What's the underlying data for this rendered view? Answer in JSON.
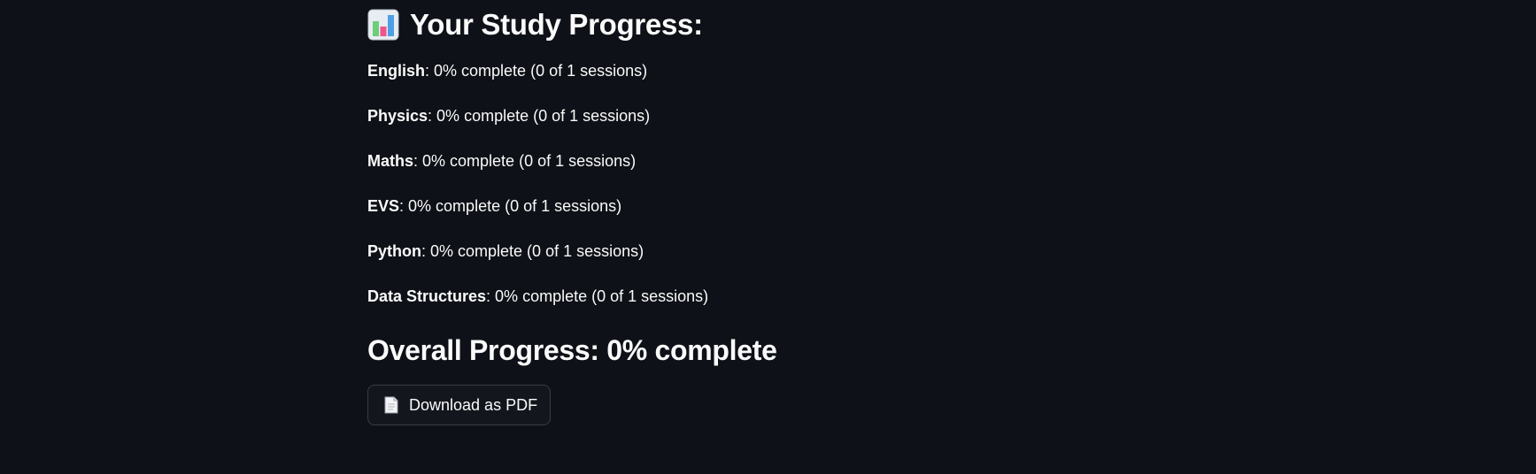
{
  "header": {
    "icon": "bar-chart-icon",
    "title": "Your Study Progress:"
  },
  "subjects": [
    {
      "name": "English",
      "suffix": ": 0% complete (0 of 1 sessions)",
      "percent": 0,
      "done": 0,
      "total": 1
    },
    {
      "name": "Physics",
      "suffix": ": 0% complete (0 of 1 sessions)",
      "percent": 0,
      "done": 0,
      "total": 1
    },
    {
      "name": "Maths",
      "suffix": ": 0% complete (0 of 1 sessions)",
      "percent": 0,
      "done": 0,
      "total": 1
    },
    {
      "name": "EVS",
      "suffix": ": 0% complete (0 of 1 sessions)",
      "percent": 0,
      "done": 0,
      "total": 1
    },
    {
      "name": "Python",
      "suffix": ": 0% complete (0 of 1 sessions)",
      "percent": 0,
      "done": 0,
      "total": 1
    },
    {
      "name": "Data Structures",
      "suffix": ": 0% complete (0 of 1 sessions)",
      "percent": 0,
      "done": 0,
      "total": 1
    }
  ],
  "overall": {
    "text": "Overall Progress: 0% complete"
  },
  "download": {
    "icon": "document-icon",
    "label": "Download as PDF"
  },
  "colors": {
    "background": "#0e1117",
    "text": "#fafafa",
    "button_border": "#3a3d46"
  }
}
